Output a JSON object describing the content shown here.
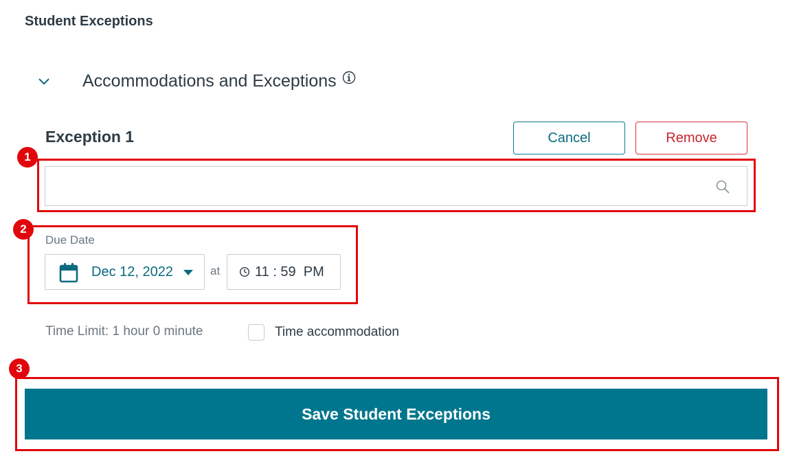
{
  "page": {
    "title": "Student Exceptions"
  },
  "section": {
    "title": "Accommodations and Exceptions",
    "expanded": true
  },
  "exception": {
    "title": "Exception 1",
    "cancel_label": "Cancel",
    "remove_label": "Remove",
    "search_value": "",
    "search_placeholder": ""
  },
  "due": {
    "label": "Due Date",
    "date": "Dec 12, 2022",
    "at_label": "at",
    "time": "11 : 59  PM"
  },
  "time_limit": {
    "text": "Time Limit: 1 hour 0 minute",
    "accommodation_label": "Time accommodation",
    "accommodation_checked": false
  },
  "save": {
    "label": "Save Student Exceptions"
  },
  "callouts": [
    {
      "number": "1"
    },
    {
      "number": "2"
    },
    {
      "number": "3"
    }
  ],
  "colors": {
    "primary": "#00768e",
    "link": "#0b6a80",
    "danger": "#c9232c",
    "callout": "#e1060b",
    "text": "#2d3b45",
    "muted": "#6b7780",
    "border": "#c7cdd1"
  },
  "icons": {
    "chevron": "chevron-down-icon",
    "info": "info-icon",
    "search": "search-icon",
    "calendar": "calendar-icon",
    "caret": "caret-down-icon",
    "clock": "clock-icon"
  }
}
